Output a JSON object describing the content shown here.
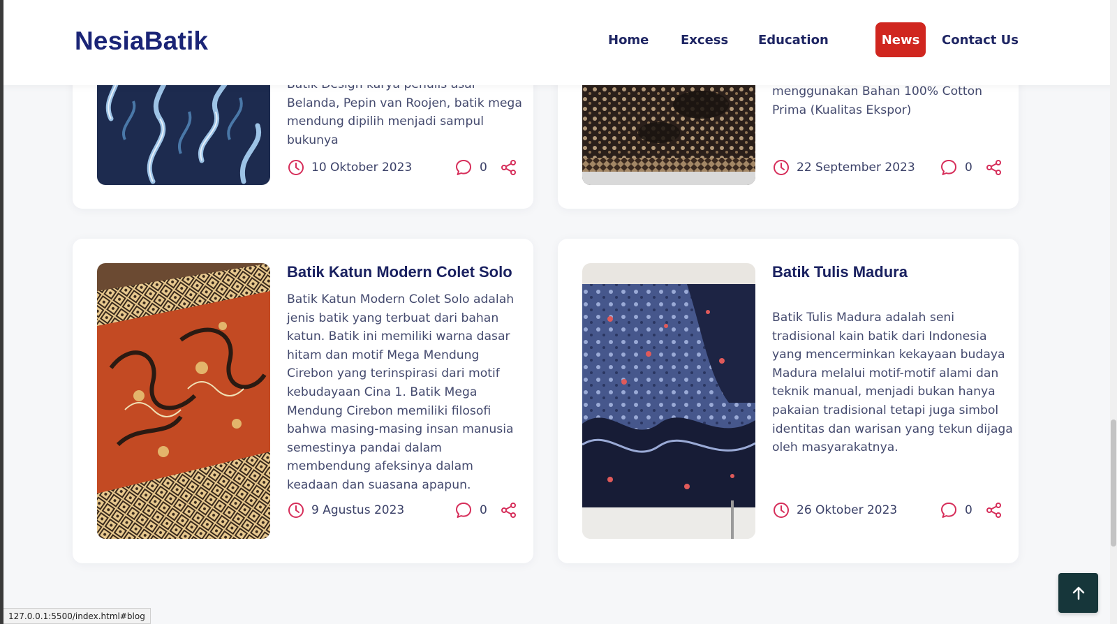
{
  "navbar": {
    "brand": "NesiaBatik",
    "links": [
      "Home",
      "Excess",
      "Education",
      "News",
      "Contact Us"
    ],
    "active": "News",
    "active_color": "#d0261f"
  },
  "cards": [
    {
      "title": "",
      "text": "Batik Design karya penulis asal Belanda, Pepin van Roojen, batik mega mendung dipilih menjadi sampul bukunya",
      "date": "10 Oktober 2023",
      "comments": "0",
      "image": "batik-mega-mendung-blue"
    },
    {
      "title": "",
      "text": "menggunakan Bahan 100% Cotton Prima (Kualitas Ekspor)",
      "date": "22 September 2023",
      "comments": "0",
      "image": "batik-brown-pattern"
    },
    {
      "title": "Batik Katun Modern Colet Solo",
      "text": "Batik Katun Modern Colet Solo adalah jenis batik yang terbuat dari bahan katun. Batik ini memiliki warna dasar hitam dan motif Mega Mendung Cirebon yang terinspirasi dari motif kebudayaan Cina 1. Batik Mega Mendung Cirebon memiliki filosofi bahwa masing-masing insan manusia semestinya pandai dalam membendung afeksinya dalam keadaan dan suasana apapun.",
      "date": "9 Agustus 2023",
      "comments": "0",
      "image": "batik-colet-orange"
    },
    {
      "title": "Batik Tulis Madura",
      "text": "Batik Tulis Madura adalah seni tradisional kain batik dari Indonesia yang mencerminkan kekayaan budaya Madura melalui motif-motif alami dan teknik manual, menjadi bukan hanya pakaian tradisional tetapi juga simbol identitas dan warisan yang tekun dijaga oleh masyarakatnya.",
      "date": "26 Oktober 2023",
      "comments": "0",
      "image": "batik-tulis-blue"
    }
  ],
  "icons": {
    "clock": "clock-icon",
    "comment": "comment-icon",
    "share": "share-icon",
    "back_to_top": "arrow-up-icon",
    "icon_color": "#d62e5a"
  },
  "status_bar": {
    "url": "127.0.0.1:5500/index.html#blog"
  }
}
